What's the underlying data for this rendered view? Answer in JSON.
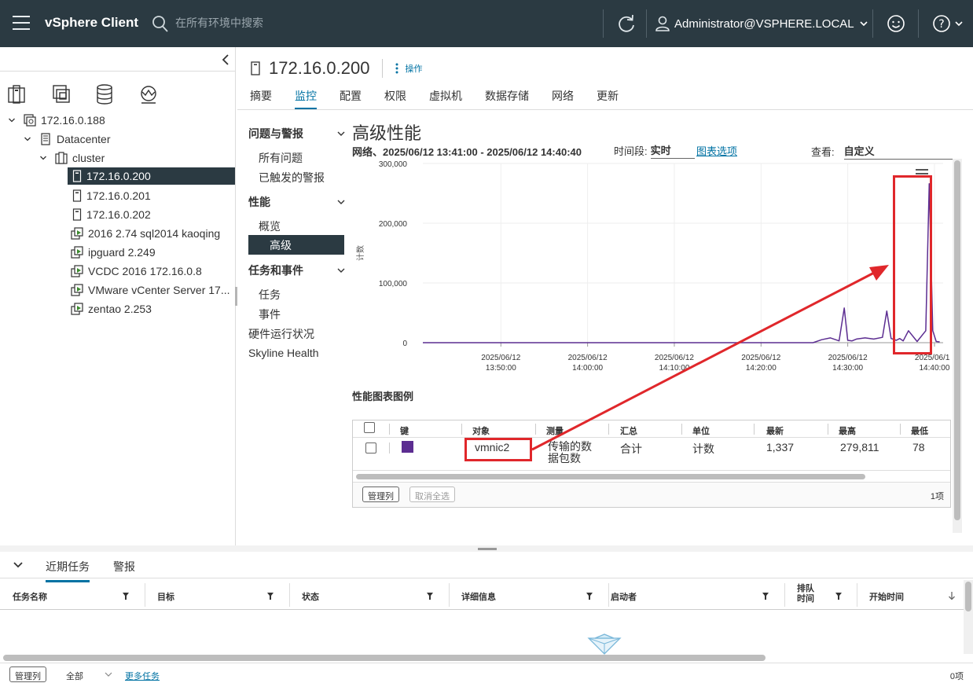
{
  "header": {
    "brand": "vSphere Client",
    "search_placeholder": "在所有环境中搜索",
    "user": "Administrator@VSPHERE.LOCAL"
  },
  "nav": {
    "tree": [
      {
        "label": "172.16.0.188",
        "type": "vcenter"
      },
      {
        "label": "Datacenter",
        "type": "datacenter"
      },
      {
        "label": "cluster",
        "type": "cluster"
      },
      {
        "label": "172.16.0.200",
        "type": "host",
        "selected": true
      },
      {
        "label": "172.16.0.201",
        "type": "host"
      },
      {
        "label": "172.16.0.202",
        "type": "host"
      },
      {
        "label": "2016 2.74 sql2014 kaoqing",
        "type": "vm"
      },
      {
        "label": "ipguard 2.249",
        "type": "vm"
      },
      {
        "label": "VCDC 2016 172.16.0.8",
        "type": "vm"
      },
      {
        "label": "VMware vCenter Server 17...",
        "type": "vm"
      },
      {
        "label": "zentao 2.253",
        "type": "vm"
      }
    ]
  },
  "main": {
    "title": "172.16.0.200",
    "actions_label": "操作",
    "tabs": [
      "摘要",
      "监控",
      "配置",
      "权限",
      "虚拟机",
      "数据存储",
      "网络",
      "更新"
    ],
    "active_tab": "监控"
  },
  "monitor_menu": {
    "groups": {
      "issues": "问题与警报",
      "performance": "性能",
      "tasks": "任务和事件"
    },
    "items": {
      "all_issues": "所有问题",
      "triggered_alarms": "已触发的警报",
      "overview": "概览",
      "advanced": "高级",
      "tasks": "任务",
      "events": "事件",
      "hardware": "硬件运行状况",
      "skyline": "Skyline Health"
    }
  },
  "advanced": {
    "title": "高级性能",
    "subtitle": "网络、2025/06/12 13:41:00 - 2025/06/12 14:40:40",
    "period_label": "时间段:",
    "period_value": "实时",
    "chart_options": "图表选项",
    "view_label": "查看:",
    "view_value": "自定义",
    "legend_title": "性能图表图例"
  },
  "chart_data": {
    "type": "line",
    "ylabel": "计数",
    "ylim": [
      0,
      300000
    ],
    "yticks": [
      "300,000",
      "200,000",
      "100,000",
      "0"
    ],
    "xticks": [
      {
        "date": "2025/06/12",
        "time": "13:50:00"
      },
      {
        "date": "2025/06/12",
        "time": "14:00:00"
      },
      {
        "date": "2025/06/12",
        "time": "14:10:00"
      },
      {
        "date": "2025/06/12",
        "time": "14:20:00"
      },
      {
        "date": "2025/06/12",
        "time": "14:30:00"
      },
      {
        "date": "2025/06/12",
        "time": "14:40:00"
      }
    ],
    "series": [
      {
        "color": "#5c2d91",
        "x_minutes_from_1341": [
          0,
          10,
          20,
          30,
          40,
          45,
          46,
          47,
          48,
          48.6,
          49,
          49.5,
          50,
          51,
          52,
          53,
          53.5,
          54,
          54.6,
          55,
          55.4,
          56,
          57,
          58,
          58.4,
          58.8,
          59.2,
          59.6
        ],
        "values": [
          0,
          0,
          0,
          0,
          0,
          0,
          5000,
          8000,
          3000,
          58000,
          4000,
          3000,
          6000,
          8000,
          6000,
          9000,
          53000,
          7000,
          4000,
          7000,
          3000,
          20000,
          2000,
          20000,
          266000,
          20000,
          2000,
          1337
        ]
      }
    ]
  },
  "legend_table": {
    "headers": [
      "键",
      "对象",
      "测量",
      "汇总",
      "单位",
      "最新",
      "最高",
      "最低"
    ],
    "rows": [
      {
        "key_color": "#5c2d91",
        "object": "vmnic2",
        "measure_l1": "传输的数",
        "measure_l2": "据包数",
        "rollup": "合计",
        "unit": "计数",
        "latest": "1,337",
        "max": "279,811",
        "min": "78"
      }
    ],
    "manage_columns": "管理列",
    "deselect_all": "取消全选",
    "count": "1项"
  },
  "bottom": {
    "tabs": [
      "近期任务",
      "警报"
    ],
    "columns": [
      "任务名称",
      "目标",
      "状态",
      "详细信息",
      "启动者",
      "排队时间",
      "开始时间"
    ],
    "manage_columns": "管理列",
    "filter_all": "全部",
    "more_tasks": "更多任务",
    "count": "0项"
  },
  "colors": {
    "header_bg": "#2b3a42",
    "accent": "#0072a3",
    "annotation": "#e0272b",
    "series": "#5c2d91"
  }
}
